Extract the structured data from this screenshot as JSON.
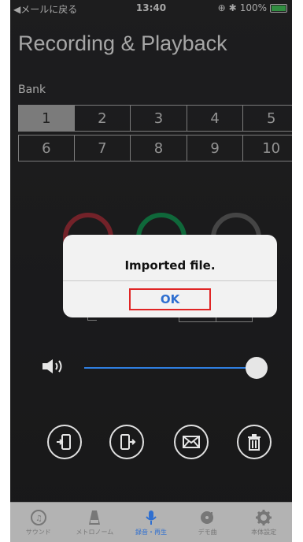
{
  "status_bar": {
    "back_label": "◀メールに戻る",
    "time": "13:40",
    "battery_text": "100%"
  },
  "header": {
    "title": "Recording & Playback"
  },
  "bank": {
    "label": "Bank",
    "selected": "1",
    "buttons": [
      "1",
      "2",
      "3",
      "4",
      "5",
      "6",
      "7",
      "8",
      "9",
      "10"
    ]
  },
  "volume": {
    "level": 0.9
  },
  "actions": [
    "import-to-phone-icon",
    "export-from-phone-icon",
    "mail-icon",
    "trash-icon"
  ],
  "dialog": {
    "message": "Imported file.",
    "ok_label": "OK"
  },
  "tabs": [
    {
      "label": "サウンド",
      "icon": "sound-icon",
      "active": false
    },
    {
      "label": "メトロノーム",
      "icon": "metronome-icon",
      "active": false
    },
    {
      "label": "録音・再生",
      "icon": "microphone-icon",
      "active": true
    },
    {
      "label": "デモ曲",
      "icon": "demo-song-icon",
      "active": false
    },
    {
      "label": "本体設定",
      "icon": "gear-icon",
      "active": false
    }
  ],
  "colors": {
    "accent": "#2f6fd0",
    "record": "#b1353f",
    "play": "#18a05a",
    "highlight_border": "#e02525"
  }
}
